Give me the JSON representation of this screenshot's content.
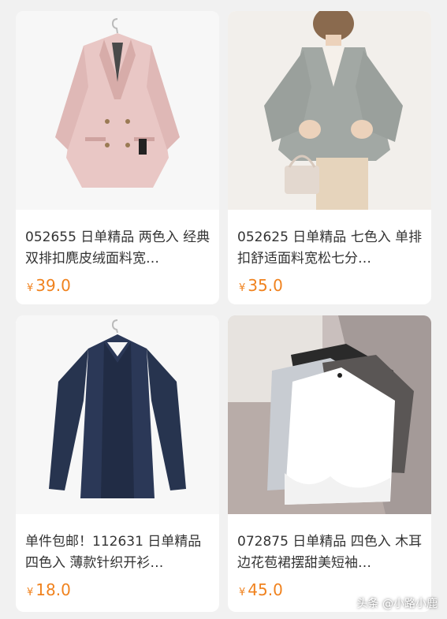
{
  "products": [
    {
      "title": "052655 日单精品 两色入 经典双排扣麂皮绒面料宽…",
      "currency": "¥",
      "price": "39.0",
      "image": "pink-blazer"
    },
    {
      "title": "052625 日单精品 七色入 单排扣舒适面料宽松七分…",
      "currency": "¥",
      "price": "35.0",
      "image": "grey-shirt"
    },
    {
      "title": "单件包邮！112631 日单精品 四色入 薄款针织开衫…",
      "currency": "¥",
      "price": "18.0",
      "image": "navy-cardigan"
    },
    {
      "title": "072875 日单精品 四色入 木耳边花苞裙摆甜美短袖…",
      "currency": "¥",
      "price": "45.0",
      "image": "ruffle-tops"
    }
  ],
  "watermark": "头条 @小路小鹿",
  "colors": {
    "price": "#f0821e",
    "background": "#f1f1f1"
  }
}
